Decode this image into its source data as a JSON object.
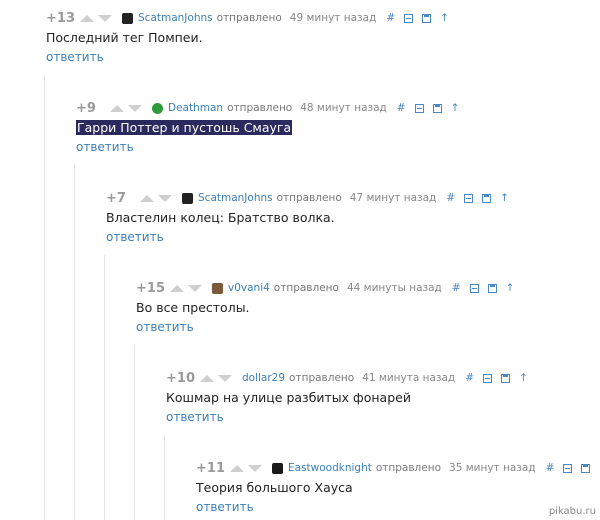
{
  "comments": [
    {
      "rating": "+13",
      "author": "ScatmanJohns",
      "sent": "отправлено",
      "time": "49 минут назад",
      "text": "Последний тег Помпеи.",
      "reply": "ответить",
      "avatar_color": "#222222"
    },
    {
      "rating": "+9",
      "author": "Deathman",
      "sent": "отправлено",
      "time": "48 минут назад",
      "text": "Гарри Поттер и пустошь Смауга",
      "reply": "ответить",
      "avatar_color": "#2e9a3c",
      "selected": true
    },
    {
      "rating": "+7",
      "author": "ScatmanJohns",
      "sent": "отправлено",
      "time": "47 минут назад",
      "text": "Властелин колец: Братство волка.",
      "reply": "ответить",
      "avatar_color": "#222222"
    },
    {
      "rating": "+15",
      "author": "v0vani4",
      "sent": "отправлено",
      "time": "44 минуты назад",
      "text": "Во все престолы.",
      "reply": "ответить",
      "avatar_color": "#7a5a3a"
    },
    {
      "rating": "+10",
      "author": "dollar29",
      "sent": "отправлено",
      "time": "41 минута назад",
      "text": "Кошмар на улице разбитых фонарей",
      "reply": "ответить",
      "avatar_color": "#ffffff"
    },
    {
      "rating": "+11",
      "author": "Eastwoodknight",
      "sent": "отправлено",
      "time": "35 минут назад",
      "text": "Теория большого Хауса",
      "reply": "ответить",
      "avatar_color": "#1a1a1a"
    }
  ],
  "tools": {
    "link": "#",
    "collapse": "collapse-icon",
    "save": "save-icon",
    "up": "↑"
  },
  "watermark": "pikabu.ru"
}
